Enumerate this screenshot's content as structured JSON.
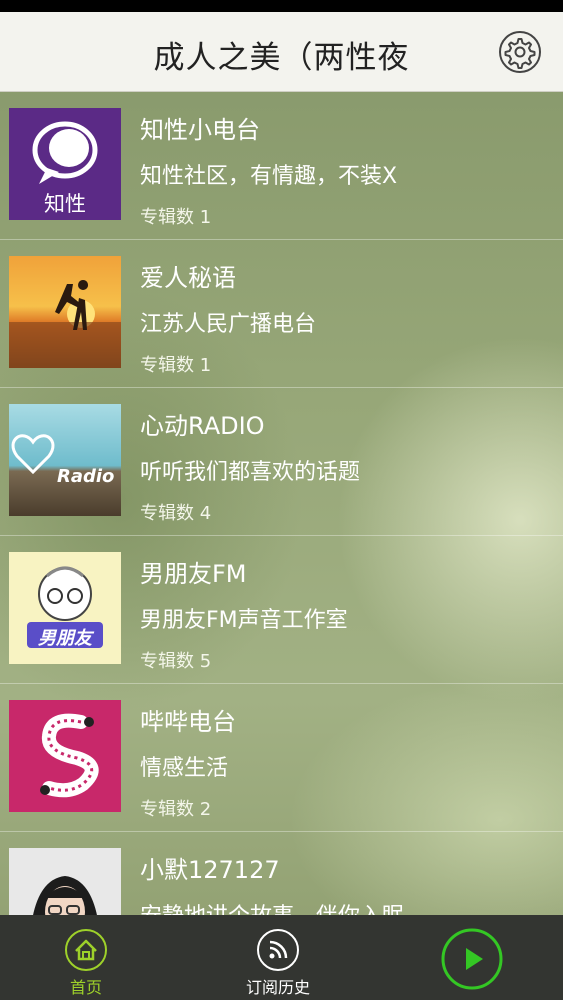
{
  "nav": {
    "title": "成人之美（两性夜",
    "settings_icon": "gear-icon"
  },
  "items": [
    {
      "title": "知性小电台",
      "subtitle": "知性社区，有情趣，不装X",
      "count": "专辑数 1",
      "thumb_label": "知性",
      "thumb_color": "#5b2a86"
    },
    {
      "title": "爱人秘语",
      "subtitle": "江苏人民广播电台",
      "count": "专辑数 1",
      "thumb_color": "#e6892c"
    },
    {
      "title": "心动RADIO",
      "subtitle": "听听我们都喜欢的话题",
      "count": "专辑数 4",
      "thumb_label": "Radio",
      "thumb_color": "#7cc6d6"
    },
    {
      "title": "男朋友FM",
      "subtitle": "男朋友FM声音工作室",
      "count": "专辑数 5",
      "thumb_label": "男朋友",
      "thumb_color": "#f3e9a4"
    },
    {
      "title": "哔哔电台",
      "subtitle": "情感生活",
      "count": "专辑数 2",
      "thumb_color": "#c8286a"
    },
    {
      "title": "小默127127",
      "subtitle": "安静地讲个故事，伴你入眠",
      "count": "",
      "thumb_color": "#e8e8e8"
    }
  ],
  "tabs": {
    "home_label": "首页",
    "history_label": "订阅历史",
    "active_color": "#9ed12a",
    "play_icon": "play-icon"
  }
}
